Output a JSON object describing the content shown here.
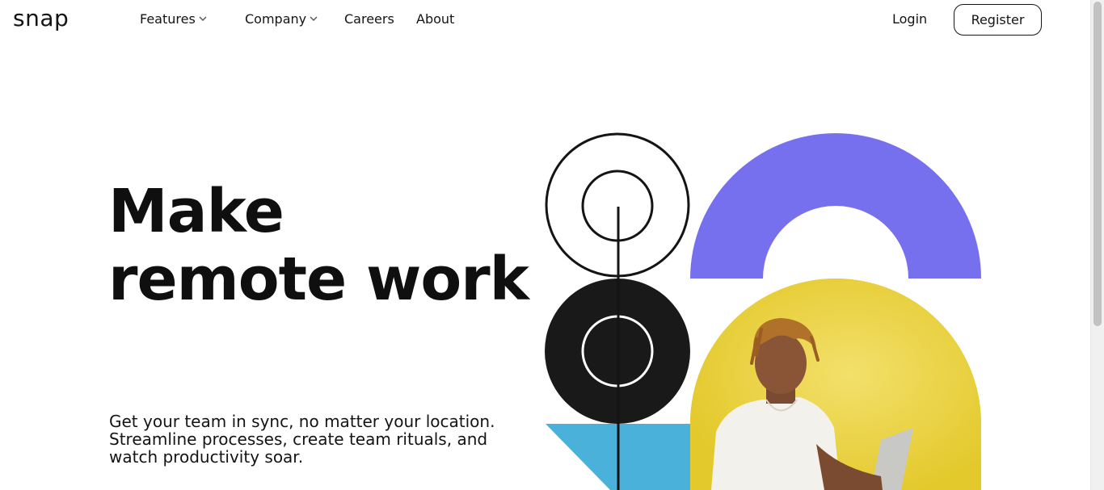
{
  "brand": {
    "logo": "snap"
  },
  "nav": {
    "features": "Features",
    "company": "Company",
    "careers": "Careers",
    "about": "About",
    "login": "Login",
    "register": "Register"
  },
  "hero": {
    "headline_line1": "Make",
    "headline_line2": "remote work",
    "subtext_line1": "Get your team in sync, no matter your location.",
    "subtext_line2": "Streamline processes, create team rituals, and",
    "subtext_line3": "watch productivity soar."
  },
  "colors": {
    "purple": "#7670ee",
    "yellow": "#e5cc36",
    "blue": "#4ab1da",
    "black": "#191919"
  },
  "icons": {
    "dropdown": "chevron-down-icon"
  }
}
